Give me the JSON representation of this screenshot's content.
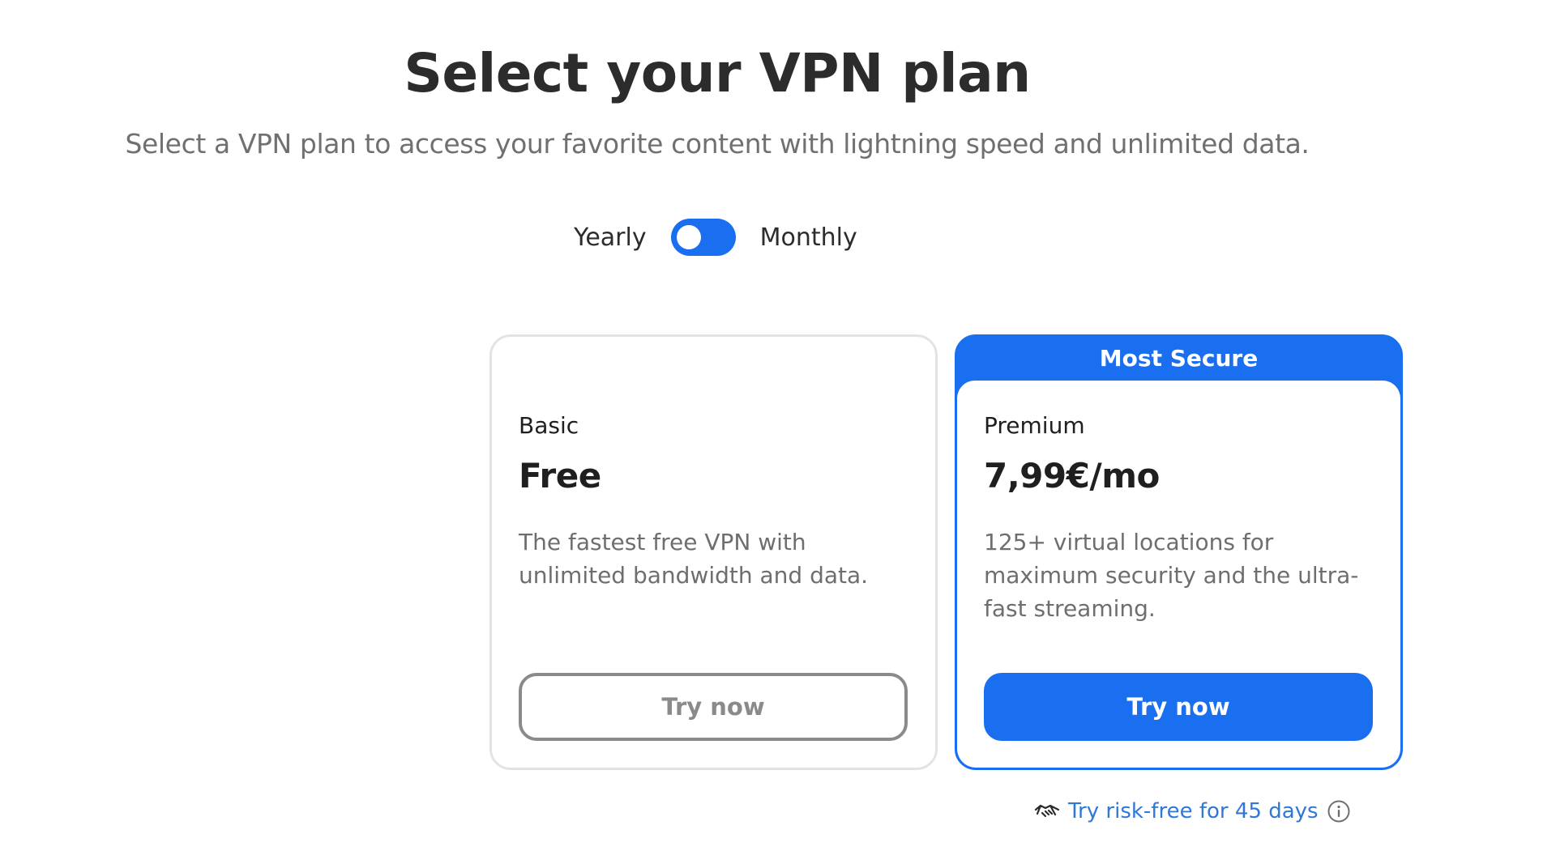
{
  "header": {
    "title": "Select your VPN plan",
    "subtitle": "Select a VPN plan to access your favorite content with lightning speed and unlimited data."
  },
  "billing_toggle": {
    "left_label": "Yearly",
    "right_label": "Monthly",
    "active_color": "#1a6ef0"
  },
  "plans": [
    {
      "name": "Basic",
      "price": "Free",
      "description": "The fastest free VPN with unlimited bandwidth and data.",
      "cta_label": "Try now",
      "cta_style": "outline"
    },
    {
      "badge": "Most Secure",
      "name": "Premium",
      "price": "7,99€/mo",
      "description": "125+ virtual locations for maximum security and the ultra-fast streaming.",
      "cta_label": "Try now",
      "cta_style": "solid",
      "accent_color": "#1a6ef0"
    }
  ],
  "guarantee": {
    "text": "Try risk-free for 45 days",
    "icon": "handshake-icon",
    "info_icon": "info-icon",
    "color": "#2f78d6"
  }
}
